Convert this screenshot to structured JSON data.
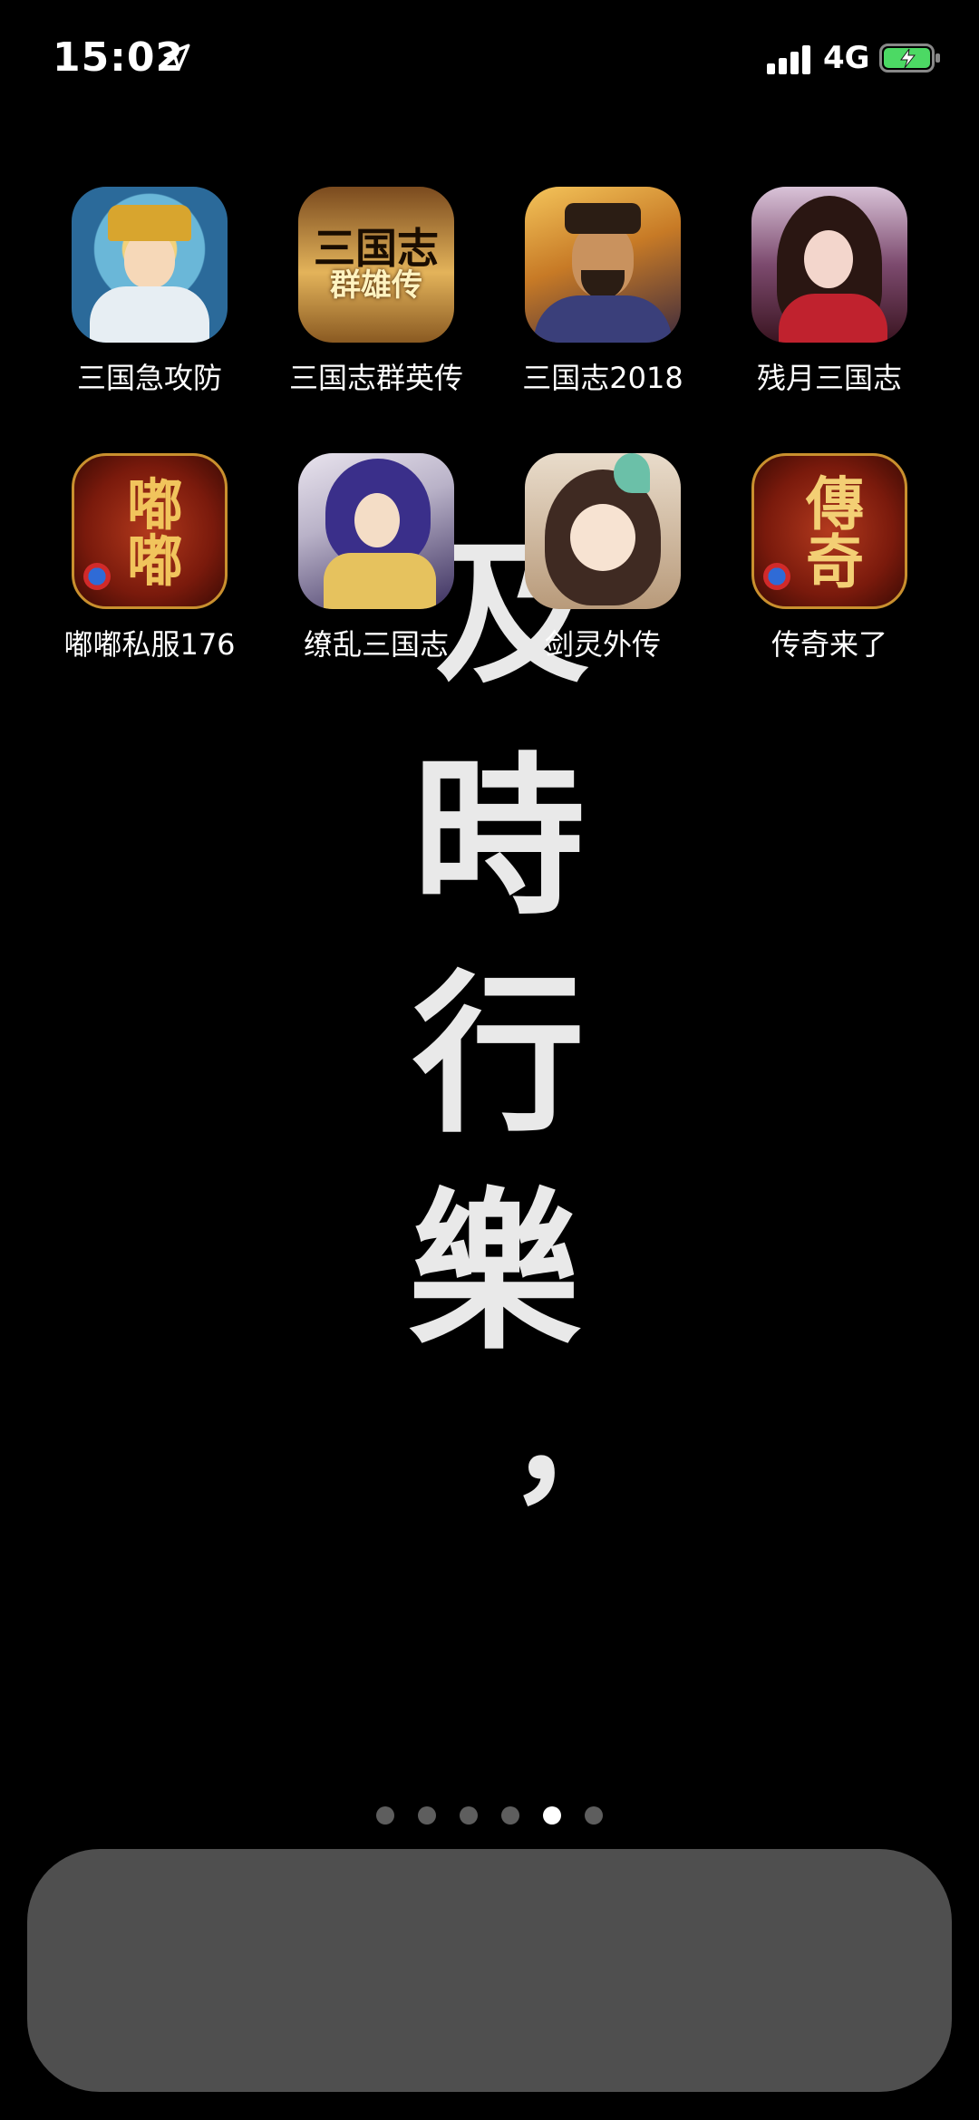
{
  "status_bar": {
    "time": "15:02",
    "network": "4G",
    "battery_color": "#4cd964"
  },
  "wallpaper": {
    "characters": [
      "及",
      "時",
      "行",
      "樂",
      "，"
    ]
  },
  "apps": [
    {
      "label": "三国急攻防",
      "icon": "hero-portrait-icon",
      "glyph": ""
    },
    {
      "label": "三国志群英传",
      "icon": "sanguozhi-logo-icon",
      "glyph": "三国志\n群雄传"
    },
    {
      "label": "三国志2018",
      "icon": "warlord-portrait-icon",
      "glyph": ""
    },
    {
      "label": "残月三国志",
      "icon": "heroine-portrait-icon",
      "glyph": ""
    },
    {
      "label": "嘟嘟私服176",
      "icon": "dudu-logo-icon",
      "glyph": "嘟嘟"
    },
    {
      "label": "缭乱三国志",
      "icon": "samurai-portrait-icon",
      "glyph": ""
    },
    {
      "label": "剑灵外传",
      "icon": "girl-portrait-icon",
      "glyph": ""
    },
    {
      "label": "传奇来了",
      "icon": "chuanqi-logo-icon",
      "glyph": "傳奇"
    }
  ],
  "page_dots": {
    "count": 6,
    "active_index": 4
  }
}
